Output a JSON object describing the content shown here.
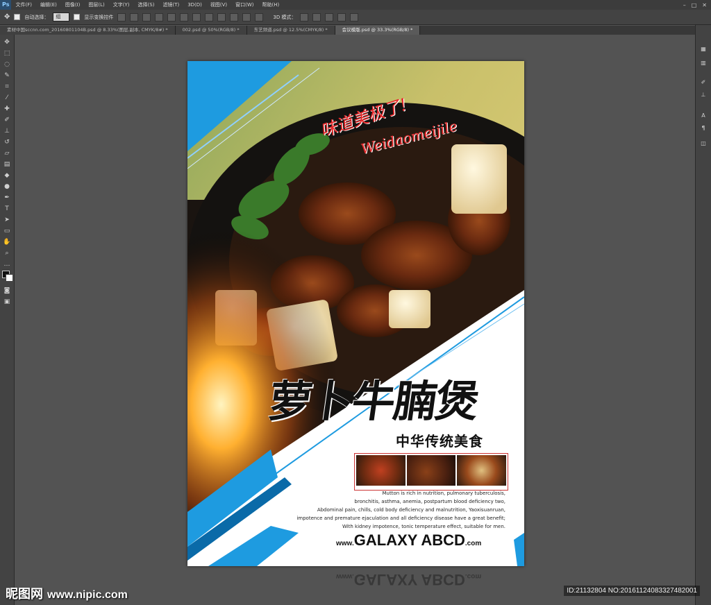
{
  "app": {
    "logo": "Ps"
  },
  "menu": [
    "文件(F)",
    "编辑(E)",
    "图像(I)",
    "图层(L)",
    "文字(Y)",
    "选择(S)",
    "滤镜(T)",
    "3D(D)",
    "视图(V)",
    "窗口(W)",
    "帮助(H)"
  ],
  "options": {
    "auto_select_label": "自动选择：",
    "auto_select_value": "组",
    "transform_label": "显示变换控件",
    "mode_3d_label": "3D 模式："
  },
  "tabs": [
    {
      "label": "素材中国sccnn.com_20160801104B.psd @ 8.33%(图层,副本, CMYK/8#) *",
      "active": false
    },
    {
      "label": "002.psd @ 50%(RGB/8) *",
      "active": false
    },
    {
      "label": "东艺频道.psd @ 12.5%(CMYK/8) *",
      "active": false
    },
    {
      "label": "会议模版.psd @ 33.3%(RGB/8) *",
      "active": true
    }
  ],
  "poster": {
    "slogan_cn": "味道美极了!",
    "slogan_en": "Weidaomeijile",
    "title": "萝卜牛腩煲",
    "subtitle": "中华传统美食",
    "description": [
      "Mutton is rich in nutrition, pulmonary tuberculosis,",
      "bronchitis, asthma, anemia, postpartum blood deficiency two,",
      "Abdominal pain, chills, cold body deficiency and malnutrition, Yaoxisuanruan,",
      "impotence and premature ejaculation and all deficiency disease have a great benefit;",
      "With kidney impotence, tonic temperature effect, suitable for men."
    ],
    "url_prefix": "www.",
    "url_main": "GALAXY ABCD",
    "url_suffix": ".com"
  },
  "watermark": {
    "site_cn": "昵图网",
    "site_url": "www.nipic.com"
  },
  "image_id": "ID:21132804 NO:20161124083327482001",
  "colors": {
    "accent_blue": "#1e9be0",
    "slogan_red": "#e8282a",
    "photoshop_bg": "#535353"
  }
}
